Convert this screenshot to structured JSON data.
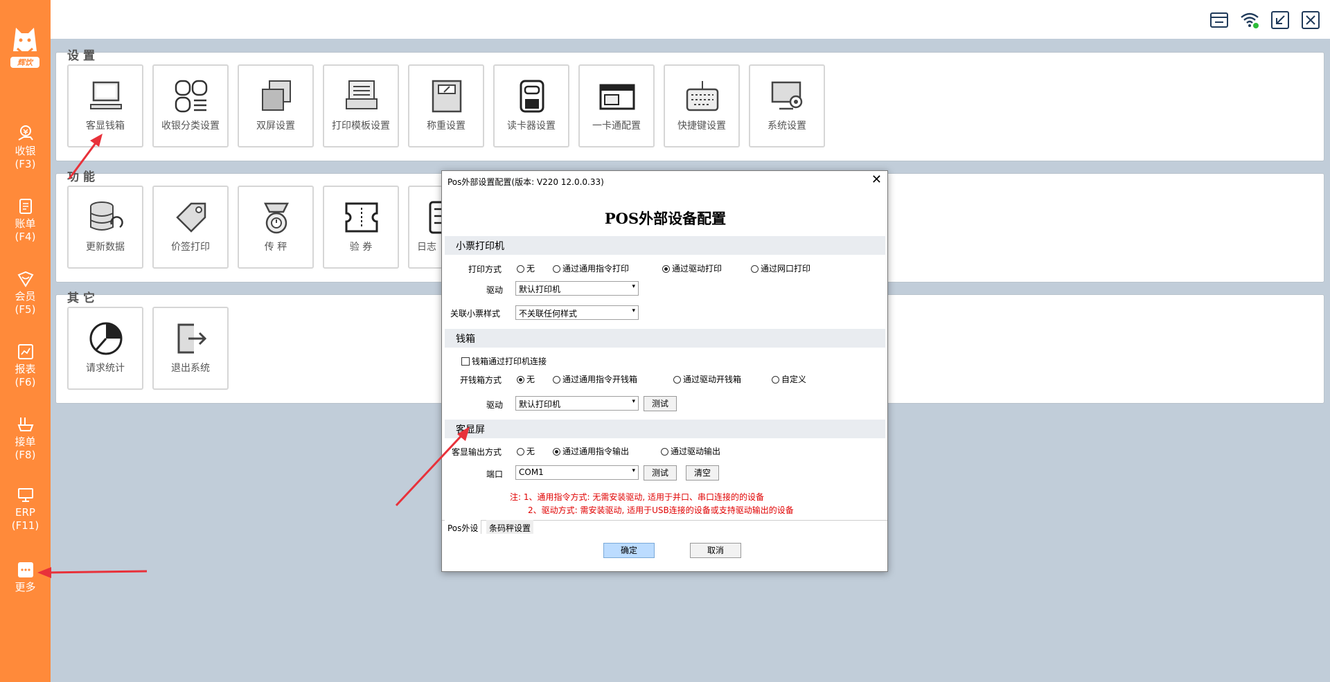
{
  "sidebar": {
    "logo_text": "辉饮",
    "items": [
      {
        "label": "收银",
        "key": "(F3)"
      },
      {
        "label": "账单",
        "key": "(F4)"
      },
      {
        "label": "会员",
        "key": "(F5)"
      },
      {
        "label": "报表",
        "key": "(F6)"
      },
      {
        "label": "接单",
        "key": "(F8)"
      },
      {
        "label": "ERP",
        "key": "(F11)"
      },
      {
        "label": "更多",
        "key": ""
      }
    ]
  },
  "topbar": {
    "icons": [
      "store-icon",
      "wifi-icon",
      "minimize-icon",
      "close-icon"
    ]
  },
  "sections": {
    "settings": {
      "title": "设置",
      "tiles": [
        "客显钱箱",
        "收银分类设置",
        "双屏设置",
        "打印模板设置",
        "称重设置",
        "读卡器设置",
        "一卡通配置",
        "快捷键设置",
        "系统设置"
      ]
    },
    "functions": {
      "title": "功能",
      "tiles": [
        "更新数据",
        "价签打印",
        "传 秤",
        "验 券",
        "日志"
      ]
    },
    "others": {
      "title": "其它",
      "tiles": [
        "请求统计",
        "退出系统"
      ]
    }
  },
  "dialog": {
    "title": "Pos外部设置配置(版本: V220  12.0.0.33)",
    "heading": "POS外部设备配置",
    "printer": {
      "section": "小票打印机",
      "print_mode_label": "打印方式",
      "print_modes": [
        "无",
        "通过通用指令打印",
        "通过驱动打印",
        "通过网口打印"
      ],
      "print_mode_selected": 2,
      "driver_label": "驱动",
      "driver_value": "默认打印机",
      "style_label": "关联小票样式",
      "style_value": "不关联任何样式"
    },
    "cashbox": {
      "section": "钱箱",
      "via_printer_label": "钱箱通过打印机连接",
      "via_printer_checked": false,
      "open_mode_label": "开钱箱方式",
      "open_modes": [
        "无",
        "通过通用指令开钱箱",
        "通过驱动开钱箱",
        "自定义"
      ],
      "open_mode_selected": 0,
      "driver_label": "驱动",
      "driver_value": "默认打印机",
      "test_button": "测试"
    },
    "display": {
      "section": "客显屏",
      "output_label": "客显输出方式",
      "output_modes": [
        "无",
        "通过通用指令输出",
        "通过驱动输出"
      ],
      "output_mode_selected": 1,
      "port_label": "端口",
      "port_value": "COM1",
      "test_button": "测试",
      "clear_button": "清空",
      "note1": "注: 1、通用指令方式: 无需安装驱动, 适用于并口、串口连接的的设备",
      "note2": "2、驱动方式: 需安装驱动, 适用于USB连接的设备或支持驱动输出的设备"
    },
    "tabs": [
      "Pos外设",
      "条码秤设置"
    ],
    "ok_button": "确定",
    "cancel_button": "取消"
  },
  "colors": {
    "sidebar": "#ff8a3a",
    "background": "#c1cdd9",
    "arrow": "#e8313a",
    "note": "#e00000"
  }
}
